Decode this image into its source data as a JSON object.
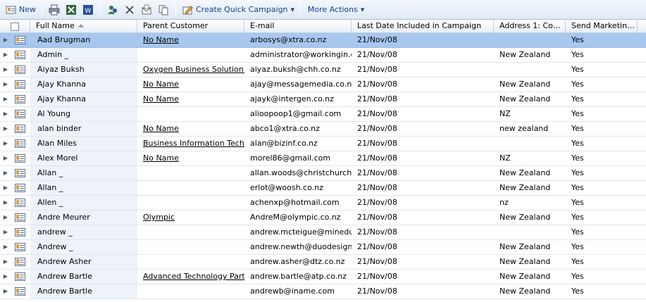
{
  "toolbar": {
    "new_label": "New",
    "quick_campaign_label": "Create Quick Campaign",
    "more_actions_label": "More Actions"
  },
  "columns": {
    "full_name": "Full Name",
    "parent_customer": "Parent Customer",
    "email": "E-mail",
    "last_date": "Last Date Included in Campaign",
    "country": "Address 1: Coun...",
    "send_marketing": "Send Marketing ..."
  },
  "rows": [
    {
      "name": "Aad Brugman",
      "parent": "No Name",
      "email": "arbosys@xtra.co.nz",
      "date": "21/Nov/08",
      "country": "",
      "send": "Yes"
    },
    {
      "name": "Admin _",
      "parent": "",
      "email": "administrator@workingin.com",
      "date": "21/Nov/08",
      "country": "New Zealand",
      "send": "Yes"
    },
    {
      "name": "Aiyaz Buksh",
      "parent": "Oxygen Business Solution Ltd",
      "email": "aiyaz.buksh@chh.co.nz",
      "date": "21/Nov/08",
      "country": "",
      "send": "Yes"
    },
    {
      "name": "Ajay Khanna",
      "parent": "No Name",
      "email": "ajay@messagemedia.co.nz",
      "date": "21/Nov/08",
      "country": "New Zealand",
      "send": "Yes"
    },
    {
      "name": "Ajay Khanna",
      "parent": "No Name",
      "email": "ajayk@intergen.co.nz",
      "date": "21/Nov/08",
      "country": "New Zealand",
      "send": "Yes"
    },
    {
      "name": "Al Young",
      "parent": "",
      "email": "alioopoop1@gmail.com",
      "date": "21/Nov/08",
      "country": "NZ",
      "send": "Yes"
    },
    {
      "name": "alan binder",
      "parent": "No Name",
      "email": "abco1@xtra.co.nz",
      "date": "21/Nov/08",
      "country": "new zealand",
      "send": "Yes"
    },
    {
      "name": "Alan Miles",
      "parent": "Business Information Technolo",
      "email": "alan@bizinf.co.nz",
      "date": "21/Nov/08",
      "country": "",
      "send": "Yes"
    },
    {
      "name": "Alex Morel",
      "parent": "No Name",
      "email": "morel86@gmail.com",
      "date": "21/Nov/08",
      "country": "NZ",
      "send": "Yes"
    },
    {
      "name": "Allan _",
      "parent": "",
      "email": "allan.woods@christchurch...",
      "date": "21/Nov/08",
      "country": "New Zealand",
      "send": "Yes"
    },
    {
      "name": "Allan _",
      "parent": "",
      "email": "erlot@woosh.co.nz",
      "date": "21/Nov/08",
      "country": "New Zealand",
      "send": "Yes"
    },
    {
      "name": "Allen _",
      "parent": "",
      "email": "achenxp@hotmail.com",
      "date": "21/Nov/08",
      "country": "nz",
      "send": "Yes"
    },
    {
      "name": "Andre Meurer",
      "parent": "Olympic",
      "email": "AndreM@olympic.co.nz",
      "date": "21/Nov/08",
      "country": "New Zealand",
      "send": "Yes"
    },
    {
      "name": "andrew _",
      "parent": "",
      "email": "andrew.mcteigue@minedu...",
      "date": "21/Nov/08",
      "country": "",
      "send": "Yes"
    },
    {
      "name": "Andrew _",
      "parent": "",
      "email": "andrew.newth@duodesign...",
      "date": "21/Nov/08",
      "country": "New Zealand",
      "send": "Yes"
    },
    {
      "name": "Andrew Asher",
      "parent": "",
      "email": "andrew.asher@dtz.co.nz",
      "date": "21/Nov/08",
      "country": "New Zealand",
      "send": "Yes"
    },
    {
      "name": "Andrew Bartle",
      "parent": "Advanced Technology Partne",
      "email": "andrew.bartle@atp.co.nz",
      "date": "21/Nov/08",
      "country": "New Zealand",
      "send": "Yes"
    },
    {
      "name": "Andrew Bartle",
      "parent": "",
      "email": "andrewb@iname.com",
      "date": "21/Nov/08",
      "country": "New Zealand",
      "send": "Yes"
    }
  ]
}
